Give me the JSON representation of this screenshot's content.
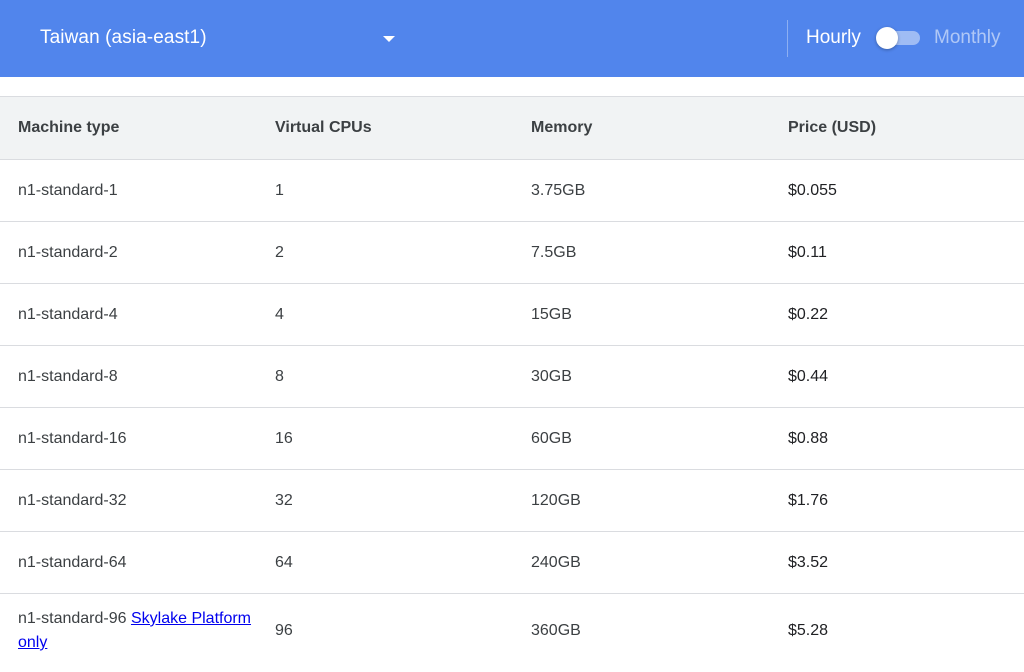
{
  "header": {
    "region_label": "Taiwan (asia-east1)",
    "hourly_label": "Hourly",
    "monthly_label": "Monthly",
    "toggle_state": "hourly",
    "bar_color": "#5185ec"
  },
  "table": {
    "columns": [
      "Machine type",
      "Virtual CPUs",
      "Memory",
      "Price (USD)"
    ],
    "rows": [
      {
        "machine": "n1-standard-1",
        "vcpus": "1",
        "memory": "3.75GB",
        "price": "$0.055"
      },
      {
        "machine": "n1-standard-2",
        "vcpus": "2",
        "memory": "7.5GB",
        "price": "$0.11"
      },
      {
        "machine": "n1-standard-4",
        "vcpus": "4",
        "memory": "15GB",
        "price": "$0.22"
      },
      {
        "machine": "n1-standard-8",
        "vcpus": "8",
        "memory": "30GB",
        "price": "$0.44"
      },
      {
        "machine": "n1-standard-16",
        "vcpus": "16",
        "memory": "60GB",
        "price": "$0.88"
      },
      {
        "machine": "n1-standard-32",
        "vcpus": "32",
        "memory": "120GB",
        "price": "$1.76"
      },
      {
        "machine": "n1-standard-64",
        "vcpus": "64",
        "memory": "240GB",
        "price": "$3.52"
      },
      {
        "machine": "n1-standard-96",
        "machine_link": "Skylake Platform only",
        "vcpus": "96",
        "memory": "360GB",
        "price": "$5.28"
      }
    ]
  }
}
